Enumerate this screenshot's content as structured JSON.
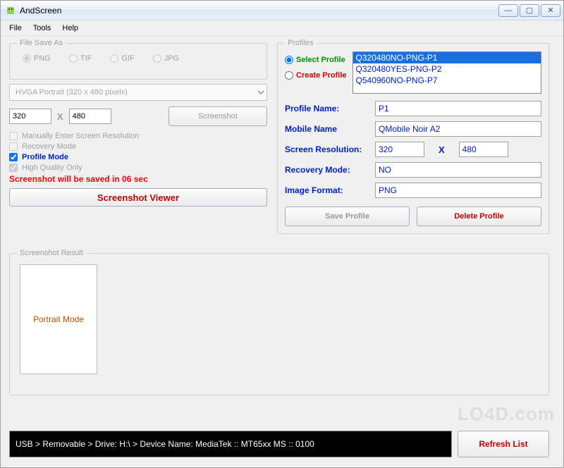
{
  "window": {
    "title": "AndScreen"
  },
  "menu": {
    "file": "File",
    "tools": "Tools",
    "help": "Help"
  },
  "fileSaveAs": {
    "legend": "File Save As",
    "png": "PNG",
    "tif": "TIF",
    "gif": "GIF",
    "jpg": "JPG"
  },
  "resolution": {
    "combo": "HVGA Portrait (320 x 480 pixels)",
    "width": "320",
    "height": "480",
    "x": "X",
    "screenshotBtn": "Screenshot"
  },
  "options": {
    "manual": "Manually Enter Screen Resolution",
    "recovery": "Recovery Mode",
    "profile": "Profile Mode",
    "hq": "High Quality Only"
  },
  "countdown": "Screenshot will be saved in  06  sec",
  "viewer": "Screenshot Viewer",
  "profiles": {
    "legend": "Profiles",
    "select": "Select Profile",
    "create": "Create Profile",
    "items": [
      "Q320480NO-PNG-P1",
      "Q320480YES-PNG-P2",
      "Q540960NO-PNG-P7"
    ],
    "fields": {
      "profileNameLabel": "Profile Name:",
      "profileName": "P1",
      "mobileNameLabel": "Mobile Name",
      "mobileName": "QMobile Noir A2",
      "resLabel": "Screen Resolution:",
      "resW": "320",
      "resH": "480",
      "recLabel": "Recovery Mode:",
      "rec": "NO",
      "fmtLabel": "Image Format:",
      "fmt": "PNG"
    },
    "saveBtn": "Save Profile",
    "deleteBtn": "Delete Profile"
  },
  "result": {
    "legend": "Screenshot Result",
    "thumb": "Portrait Mode"
  },
  "status": "USB > Removable >  Drive: H:\\ >  Device Name: MediaTek :: MT65xx MS :: 0100",
  "refresh": "Refresh List",
  "watermark": "LO4D.com"
}
